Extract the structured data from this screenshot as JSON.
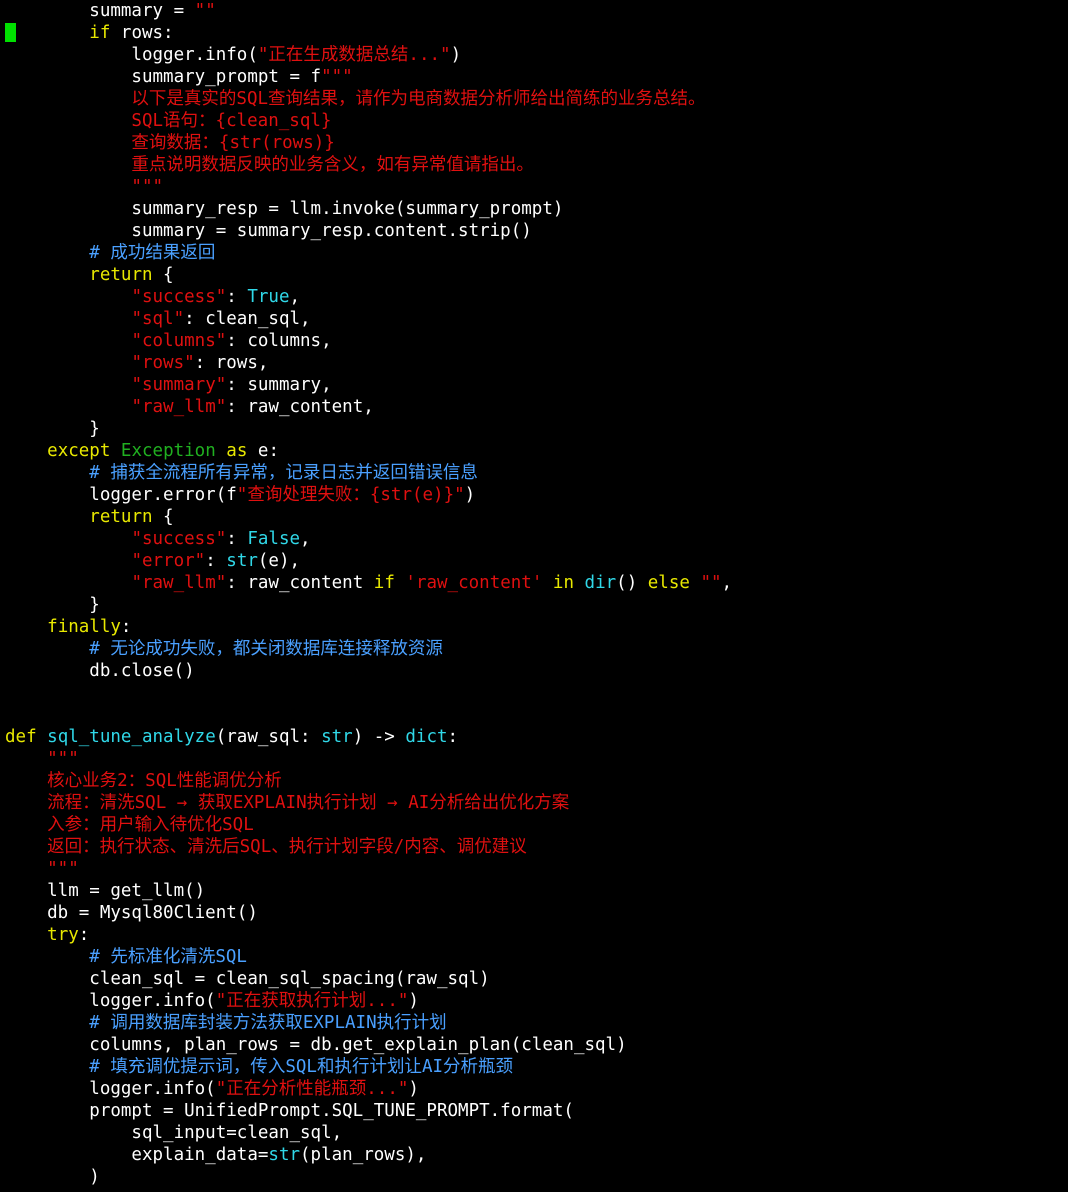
{
  "colors": {
    "background": "#000000",
    "default": "#ffffff",
    "keyword": "#e8e800",
    "string": "#e01010",
    "comment": "#4aa0ff",
    "builtin": "#30d8e8",
    "exception": "#20b020",
    "cursor": "#00e000"
  },
  "editor": {
    "cursor_line": 2,
    "lines": [
      [
        [
          "d",
          "        summary = "
        ],
        [
          "s",
          "\"\""
        ]
      ],
      [
        [
          "d",
          "        "
        ],
        [
          "k",
          "if"
        ],
        [
          "d",
          " rows:"
        ]
      ],
      [
        [
          "d",
          "            logger.info("
        ],
        [
          "s",
          "\"正在生成数据总结...\""
        ],
        [
          "d",
          ")"
        ]
      ],
      [
        [
          "d",
          "            summary_prompt = f"
        ],
        [
          "s",
          "\"\"\""
        ]
      ],
      [
        [
          "s",
          "            以下是真实的SQL查询结果，请作为电商数据分析师给出简练的业务总结。"
        ]
      ],
      [
        [
          "s",
          "            SQL语句：{clean_sql}"
        ]
      ],
      [
        [
          "s",
          "            查询数据：{str(rows)}"
        ]
      ],
      [
        [
          "s",
          "            重点说明数据反映的业务含义，如有异常值请指出。"
        ]
      ],
      [
        [
          "s",
          "            \"\"\""
        ]
      ],
      [
        [
          "d",
          "            summary_resp = llm.invoke(summary_prompt)"
        ]
      ],
      [
        [
          "d",
          "            summary = summary_resp.content.strip()"
        ]
      ],
      [
        [
          "c",
          "        # 成功结果返回"
        ]
      ],
      [
        [
          "d",
          "        "
        ],
        [
          "k",
          "return"
        ],
        [
          "d",
          " {"
        ]
      ],
      [
        [
          "d",
          "            "
        ],
        [
          "s",
          "\"success\""
        ],
        [
          "d",
          ": "
        ],
        [
          "b",
          "True"
        ],
        [
          "d",
          ","
        ]
      ],
      [
        [
          "d",
          "            "
        ],
        [
          "s",
          "\"sql\""
        ],
        [
          "d",
          ": clean_sql,"
        ]
      ],
      [
        [
          "d",
          "            "
        ],
        [
          "s",
          "\"columns\""
        ],
        [
          "d",
          ": columns,"
        ]
      ],
      [
        [
          "d",
          "            "
        ],
        [
          "s",
          "\"rows\""
        ],
        [
          "d",
          ": rows,"
        ]
      ],
      [
        [
          "d",
          "            "
        ],
        [
          "s",
          "\"summary\""
        ],
        [
          "d",
          ": summary,"
        ]
      ],
      [
        [
          "d",
          "            "
        ],
        [
          "s",
          "\"raw_llm\""
        ],
        [
          "d",
          ": raw_content,"
        ]
      ],
      [
        [
          "d",
          "        }"
        ]
      ],
      [
        [
          "d",
          "    "
        ],
        [
          "k",
          "except"
        ],
        [
          "d",
          " "
        ],
        [
          "e",
          "Exception"
        ],
        [
          "d",
          " "
        ],
        [
          "k",
          "as"
        ],
        [
          "d",
          " e:"
        ]
      ],
      [
        [
          "c",
          "        # 捕获全流程所有异常，记录日志并返回错误信息"
        ]
      ],
      [
        [
          "d",
          "        logger.error(f"
        ],
        [
          "s",
          "\"查询处理失败：{str(e)}\""
        ],
        [
          "d",
          ")"
        ]
      ],
      [
        [
          "d",
          "        "
        ],
        [
          "k",
          "return"
        ],
        [
          "d",
          " {"
        ]
      ],
      [
        [
          "d",
          "            "
        ],
        [
          "s",
          "\"success\""
        ],
        [
          "d",
          ": "
        ],
        [
          "b",
          "False"
        ],
        [
          "d",
          ","
        ]
      ],
      [
        [
          "d",
          "            "
        ],
        [
          "s",
          "\"error\""
        ],
        [
          "d",
          ": "
        ],
        [
          "b",
          "str"
        ],
        [
          "d",
          "(e),"
        ]
      ],
      [
        [
          "d",
          "            "
        ],
        [
          "s",
          "\"raw_llm\""
        ],
        [
          "d",
          ": raw_content "
        ],
        [
          "k",
          "if"
        ],
        [
          "d",
          " "
        ],
        [
          "s",
          "'raw_content'"
        ],
        [
          "d",
          " "
        ],
        [
          "k",
          "in"
        ],
        [
          "d",
          " "
        ],
        [
          "b",
          "dir"
        ],
        [
          "d",
          "() "
        ],
        [
          "k",
          "else"
        ],
        [
          "d",
          " "
        ],
        [
          "s",
          "\"\""
        ],
        [
          "d",
          ","
        ]
      ],
      [
        [
          "d",
          "        }"
        ]
      ],
      [
        [
          "d",
          "    "
        ],
        [
          "k",
          "finally"
        ],
        [
          "d",
          ":"
        ]
      ],
      [
        [
          "c",
          "        # 无论成功失败，都关闭数据库连接释放资源"
        ]
      ],
      [
        [
          "d",
          "        db.close()"
        ]
      ],
      [],
      [],
      [
        [
          "k",
          "def"
        ],
        [
          "d",
          " "
        ],
        [
          "b",
          "sql_tune_analyze"
        ],
        [
          "d",
          "(raw_sql: "
        ],
        [
          "b",
          "str"
        ],
        [
          "d",
          ") -> "
        ],
        [
          "b",
          "dict"
        ],
        [
          "d",
          ":"
        ]
      ],
      [
        [
          "s",
          "    \"\"\""
        ]
      ],
      [
        [
          "s",
          "    核心业务2：SQL性能调优分析"
        ]
      ],
      [
        [
          "s",
          "    流程：清洗SQL → 获取EXPLAIN执行计划 → AI分析给出优化方案"
        ]
      ],
      [
        [
          "s",
          "    入参：用户输入待优化SQL"
        ]
      ],
      [
        [
          "s",
          "    返回：执行状态、清洗后SQL、执行计划字段/内容、调优建议"
        ]
      ],
      [
        [
          "s",
          "    \"\"\""
        ]
      ],
      [
        [
          "d",
          "    llm = get_llm()"
        ]
      ],
      [
        [
          "d",
          "    db = Mysql80Client()"
        ]
      ],
      [
        [
          "d",
          "    "
        ],
        [
          "k",
          "try"
        ],
        [
          "d",
          ":"
        ]
      ],
      [
        [
          "c",
          "        # 先标准化清洗SQL"
        ]
      ],
      [
        [
          "d",
          "        clean_sql = clean_sql_spacing(raw_sql)"
        ]
      ],
      [
        [
          "d",
          "        logger.info("
        ],
        [
          "s",
          "\"正在获取执行计划...\""
        ],
        [
          "d",
          ")"
        ]
      ],
      [
        [
          "c",
          "        # 调用数据库封装方法获取EXPLAIN执行计划"
        ]
      ],
      [
        [
          "d",
          "        columns, plan_rows = db.get_explain_plan(clean_sql)"
        ]
      ],
      [
        [
          "c",
          "        # 填充调优提示词，传入SQL和执行计划让AI分析瓶颈"
        ]
      ],
      [
        [
          "d",
          "        logger.info("
        ],
        [
          "s",
          "\"正在分析性能瓶颈...\""
        ],
        [
          "d",
          ")"
        ]
      ],
      [
        [
          "d",
          "        prompt = UnifiedPrompt.SQL_TUNE_PROMPT.format("
        ]
      ],
      [
        [
          "d",
          "            sql_input=clean_sql,"
        ]
      ],
      [
        [
          "d",
          "            explain_data="
        ],
        [
          "b",
          "str"
        ],
        [
          "d",
          "(plan_rows),"
        ]
      ],
      [
        [
          "d",
          "        )"
        ]
      ]
    ]
  }
}
